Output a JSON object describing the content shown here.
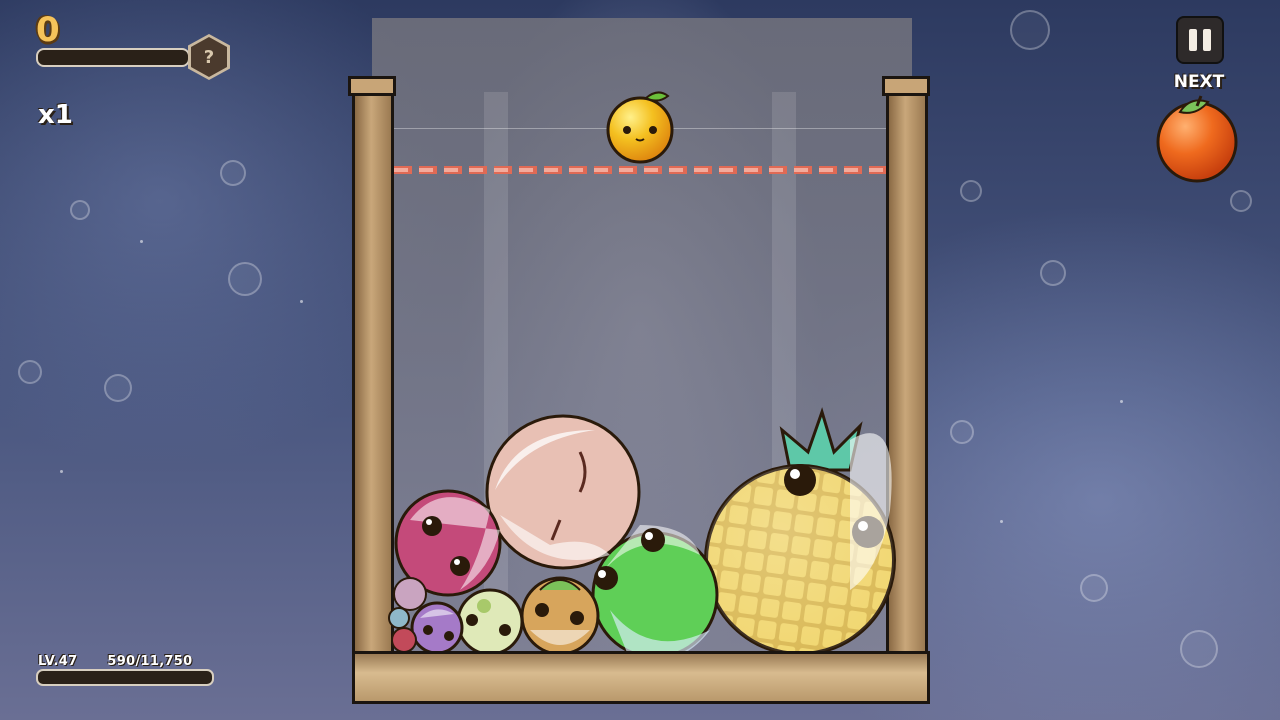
{
  "hud": {
    "score": "0",
    "evolution_badge": "?",
    "multiplier": "x1",
    "level_label": "LV.47",
    "xp_label": "590/11,750",
    "next_label": "NEXT",
    "pause_icon": "pause-icon"
  },
  "game": {
    "current_fruit": "lemon",
    "next_fruit": "orange",
    "fruits_in_container": [
      "pineapple",
      "apple",
      "peach",
      "plum",
      "green-fruit",
      "grape",
      "cherry",
      "kiwi",
      "persimmon"
    ]
  },
  "colors": {
    "score": "#f6c35a",
    "danger_line": "#e06a55",
    "wood": "#c9a77a",
    "lemon": "#f4b81e",
    "orange": "#ef6a1e",
    "pineapple": "#e8c64a",
    "apple": "#5fcf57"
  }
}
